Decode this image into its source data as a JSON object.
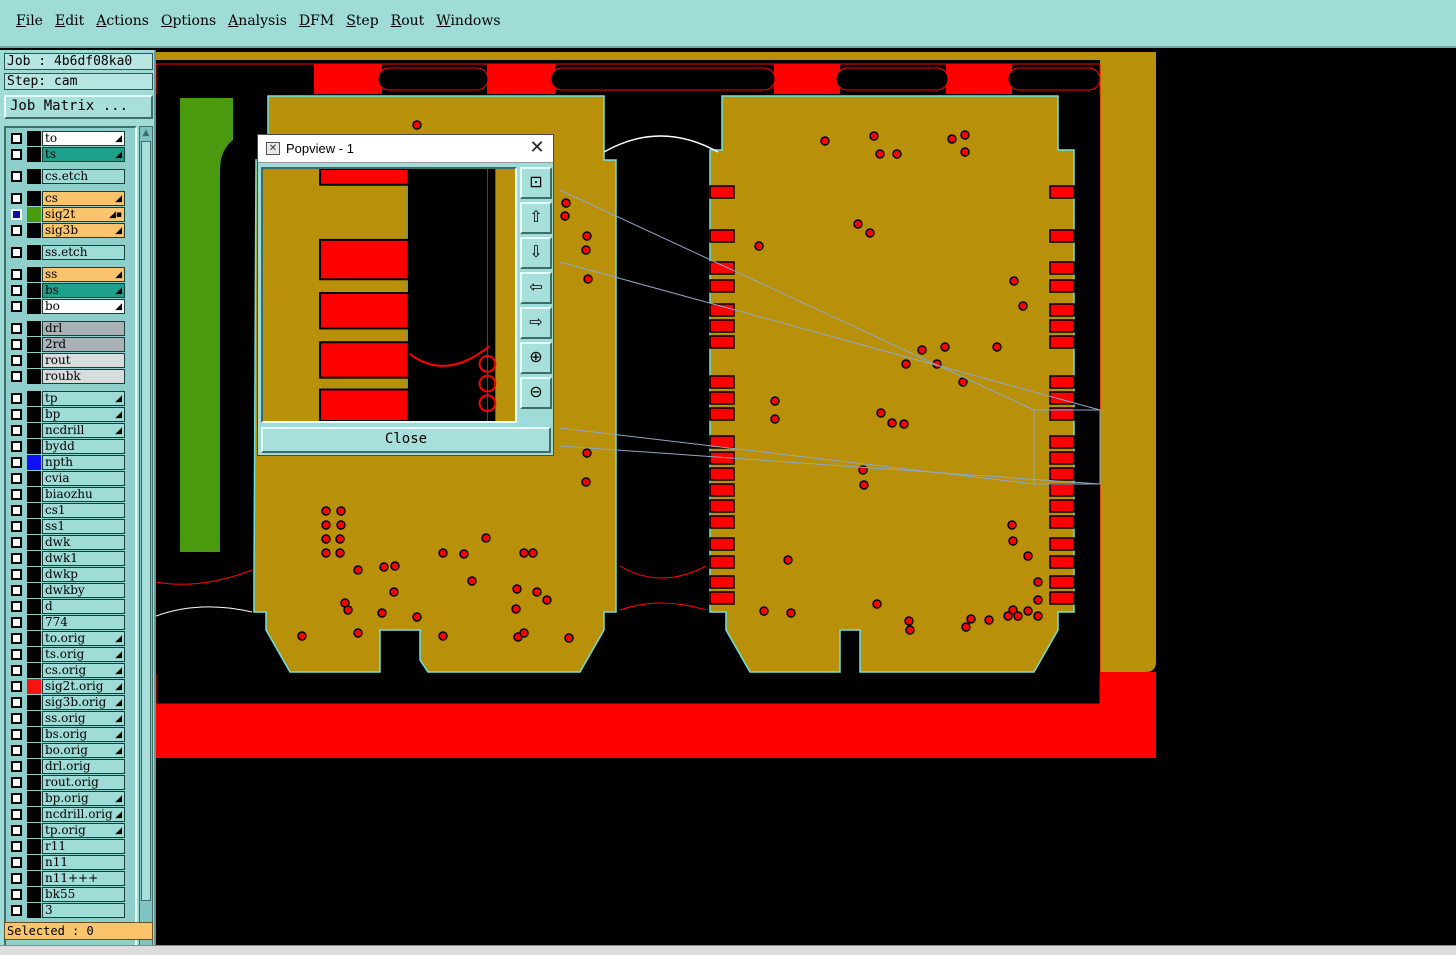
{
  "menu": [
    {
      "label": "File"
    },
    {
      "label": "Edit"
    },
    {
      "label": "Actions"
    },
    {
      "label": "Options"
    },
    {
      "label": "Analysis"
    },
    {
      "label": "DFM"
    },
    {
      "label": "Step"
    },
    {
      "label": "Rout"
    },
    {
      "label": "Windows"
    }
  ],
  "panel": {
    "job": "Job : 4b6df08ka0",
    "step": "Step: cam",
    "job_matrix": "Job Matrix ...",
    "selected": "Selected : 0"
  },
  "colors": {
    "copper": "#b8900a",
    "pad_red": "#ff0000",
    "board_green": "#4a9a10",
    "layer_signal": "#f9c46b",
    "layer_mask": "#1fa08a",
    "layer_default": "#9fdbd7",
    "layer_white": "#ffffff",
    "layer_gray": "#a9b2b6",
    "layer_light": "#d8dcdc"
  },
  "layers": [
    {
      "name": "to",
      "color": "layer_white",
      "mark": "◢"
    },
    {
      "name": "ts",
      "color": "layer_mask",
      "mark": "◢"
    },
    {
      "name": "cs.etch",
      "color": "layer_default",
      "mark": ""
    },
    {
      "name": "cs",
      "color": "layer_signal",
      "mark": "◢"
    },
    {
      "name": "sig2t",
      "color": "layer_signal",
      "mark": "◢▪",
      "swatch": "#4a9a10",
      "checked": true
    },
    {
      "name": "sig3b",
      "color": "layer_signal",
      "mark": "◢"
    },
    {
      "name": "ss.etch",
      "color": "layer_default",
      "mark": ""
    },
    {
      "name": "ss",
      "color": "layer_signal",
      "mark": "◢"
    },
    {
      "name": "bs",
      "color": "layer_mask",
      "mark": "◢"
    },
    {
      "name": "bo",
      "color": "layer_white",
      "mark": "◢"
    },
    {
      "name": "drl",
      "color": "layer_gray",
      "mark": ""
    },
    {
      "name": "2rd",
      "color": "layer_gray",
      "mark": ""
    },
    {
      "name": "rout",
      "color": "layer_light",
      "mark": ""
    },
    {
      "name": "roubk",
      "color": "layer_light",
      "mark": ""
    },
    {
      "name": "tp",
      "color": "layer_default",
      "mark": "◢"
    },
    {
      "name": "bp",
      "color": "layer_default",
      "mark": "◢"
    },
    {
      "name": "ncdrill",
      "color": "layer_default",
      "mark": "◢"
    },
    {
      "name": "bydd",
      "color": "layer_default",
      "mark": ""
    },
    {
      "name": "npth",
      "color": "layer_default",
      "mark": "",
      "swatch": "#1010ff"
    },
    {
      "name": "cvia",
      "color": "layer_default",
      "mark": ""
    },
    {
      "name": "biaozhu",
      "color": "layer_default",
      "mark": ""
    },
    {
      "name": "cs1",
      "color": "layer_default",
      "mark": ""
    },
    {
      "name": "ss1",
      "color": "layer_default",
      "mark": ""
    },
    {
      "name": "dwk",
      "color": "layer_default",
      "mark": ""
    },
    {
      "name": "dwk1",
      "color": "layer_default",
      "mark": ""
    },
    {
      "name": "dwkp",
      "color": "layer_default",
      "mark": ""
    },
    {
      "name": "dwkby",
      "color": "layer_default",
      "mark": ""
    },
    {
      "name": "d",
      "color": "layer_default",
      "mark": ""
    },
    {
      "name": "774",
      "color": "layer_default",
      "mark": ""
    },
    {
      "name": "to.orig",
      "color": "layer_default",
      "mark": "◢"
    },
    {
      "name": "ts.orig",
      "color": "layer_default",
      "mark": "◢"
    },
    {
      "name": "cs.orig",
      "color": "layer_default",
      "mark": "◢"
    },
    {
      "name": "sig2t.orig",
      "color": "layer_default",
      "mark": "◢",
      "swatch": "#ff1010"
    },
    {
      "name": "sig3b.orig",
      "color": "layer_default",
      "mark": "◢"
    },
    {
      "name": "ss.orig",
      "color": "layer_default",
      "mark": "◢"
    },
    {
      "name": "bs.orig",
      "color": "layer_default",
      "mark": "◢"
    },
    {
      "name": "bo.orig",
      "color": "layer_default",
      "mark": "◢"
    },
    {
      "name": "drl.orig",
      "color": "layer_default",
      "mark": ""
    },
    {
      "name": "rout.orig",
      "color": "layer_default",
      "mark": ""
    },
    {
      "name": "bp.orig",
      "color": "layer_default",
      "mark": "◢"
    },
    {
      "name": "ncdrill.orig",
      "color": "layer_default",
      "mark": "◢"
    },
    {
      "name": "tp.orig",
      "color": "layer_default",
      "mark": "◢"
    },
    {
      "name": "r11",
      "color": "layer_default",
      "mark": ""
    },
    {
      "name": "n11",
      "color": "layer_default",
      "mark": ""
    },
    {
      "name": "n11+++",
      "color": "layer_default",
      "mark": ""
    },
    {
      "name": "bk55",
      "color": "layer_default",
      "mark": ""
    },
    {
      "name": "3",
      "color": "layer_default",
      "mark": ""
    }
  ],
  "popview": {
    "title": "Popview - 1",
    "close_label": "Close",
    "tools": [
      "zoom-fit-icon",
      "pan-up-icon",
      "pan-down-icon",
      "pan-left-icon",
      "pan-right-icon",
      "zoom-in-icon",
      "zoom-out-icon"
    ]
  }
}
